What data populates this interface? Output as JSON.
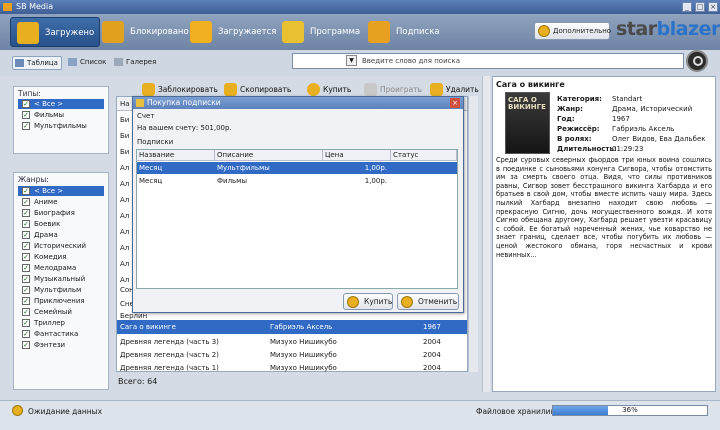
{
  "window": {
    "title": "SB Media"
  },
  "nav": {
    "tabs": [
      {
        "label": "Загружено",
        "color": "#e8b020"
      },
      {
        "label": "Блокировано",
        "color": "#e0a020"
      },
      {
        "label": "Загружается",
        "color": "#f0b020"
      },
      {
        "label": "Программа",
        "color": "#e8c030"
      },
      {
        "label": "Подписка",
        "color": "#e8a020"
      }
    ],
    "extra_button": "Дополнительно",
    "brand_part1": "star",
    "brand_part2": "blazer"
  },
  "views": {
    "table": "Таблица",
    "list": "Список",
    "gallery": "Галерея"
  },
  "search": {
    "placeholder": "Введите слово для поиска",
    "dropdown_icon": "chevron-down-icon"
  },
  "types": {
    "header": "Типы:",
    "items": [
      {
        "label": "< Все >",
        "checked": true,
        "selected": true
      },
      {
        "label": "Фильмы",
        "checked": true
      },
      {
        "label": "Мультфильмы",
        "checked": true
      }
    ]
  },
  "genres": {
    "header": "Жанры:",
    "items": [
      {
        "label": "< Все >",
        "checked": true,
        "selected": true
      },
      {
        "label": "Аниме",
        "checked": true
      },
      {
        "label": "Биография",
        "checked": true
      },
      {
        "label": "Боевик",
        "checked": true
      },
      {
        "label": "Драма",
        "checked": true
      },
      {
        "label": "Исторический",
        "checked": true
      },
      {
        "label": "Комедия",
        "checked": true
      },
      {
        "label": "Мелодрама",
        "checked": true
      },
      {
        "label": "Музыкальный",
        "checked": true
      },
      {
        "label": "Мультфильм",
        "checked": true
      },
      {
        "label": "Приключения",
        "checked": true
      },
      {
        "label": "Семейный",
        "checked": true
      },
      {
        "label": "Триллер",
        "checked": true
      },
      {
        "label": "Фантастика",
        "checked": true
      },
      {
        "label": "Фэнтези",
        "checked": true
      }
    ]
  },
  "toolbar": {
    "block": "Заблокировать",
    "copy": "Скопировать",
    "buy": "Купить",
    "play": "Проиграть",
    "delete": "Удалить"
  },
  "list": {
    "header_first": "На",
    "partial_rows": [
      "Би",
      "Би",
      "Би",
      "Ал",
      "Ал",
      "Ал",
      "Ал",
      "Ал",
      "Ал",
      "Ал",
      "Ал",
      "Сон",
      "Сне",
      "Берлин"
    ],
    "rows": [
      {
        "title": "Сага о викинге",
        "author": "Габриэль Аксель",
        "year": "1967",
        "selected": true
      },
      {
        "title": "Древняя легенда (часть 3)",
        "author": "Мизухо Нишикубо",
        "year": "2004"
      },
      {
        "title": "Древняя легенда (часть 2)",
        "author": "Мизухо Нишикубо",
        "year": "2004"
      },
      {
        "title": "Древняя легенда (часть 1)",
        "author": "Мизухо Нишикубо",
        "year": "2004"
      }
    ],
    "total": "Всего: 64"
  },
  "dialog": {
    "title": "Покупка подписки",
    "account_label": "Счет",
    "balance": "На вашем счету: 501,00р.",
    "subs_label": "Подписки",
    "columns": [
      "Название",
      "Описание",
      "Цена",
      "Статус"
    ],
    "rows": [
      {
        "name": "Месяц",
        "desc": "Мультфильмы",
        "price": "1,00р.",
        "status": "",
        "selected": true
      },
      {
        "name": "Месяц",
        "desc": "Фильмы",
        "price": "1,00р.",
        "status": ""
      }
    ],
    "buy": "Купить",
    "cancel": "Отменить"
  },
  "detail": {
    "title": "Сага о викинге",
    "poster_text": "САГА О ВИКИНГЕ",
    "fields": [
      {
        "k": "Категория:",
        "v": "Standart"
      },
      {
        "k": "Жанр:",
        "v": "Драма, Исторический"
      },
      {
        "k": "Год:",
        "v": "1967"
      },
      {
        "k": "Режиссёр:",
        "v": "Габриэль Аксель"
      },
      {
        "k": "В ролях:",
        "v": "Олег Видов,  Ева Дальбек"
      },
      {
        "k": "Длительность:",
        "v": "01:29:23"
      }
    ],
    "description": "Среди суровых северных фьордов три юных воина сошлись в поединке с сыновьями конунга Сигвора, чтобы отомстить им за смерть своего отца. Видя, что силы противников равны, Сигвор зовет бесстрашного викинга Хагбарда и его братьев в свой дом, чтобы вместе испить чашу мира. Здесь пылкий Хагбард внезапно находит свою любовь — прекрасную Сигню, дочь могущественного вождя. И хотя Сигню обещана другому, Хагбард решает увезти красавицу с собой. Ее богатый нареченный жених, чье коварство не знает границ, сделает все, чтобы погубить их любовь — ценой жестокого обмана, горя несчастных и крови невинных..."
  },
  "status": {
    "waiting": "Ожидание данных",
    "storage_label": "Файловое хранилище:",
    "storage_percent": 36,
    "storage_text": "36%"
  }
}
